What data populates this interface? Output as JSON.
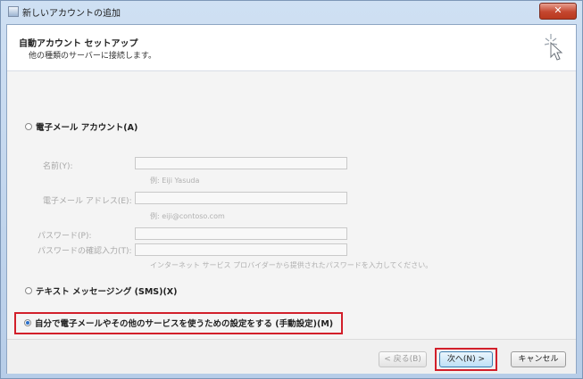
{
  "window": {
    "title": "新しいアカウントの追加",
    "close_glyph": "✕"
  },
  "header": {
    "title": "自動アカウント セットアップ",
    "subtitle": "他の種類のサーバーに接続します。"
  },
  "options": {
    "email_account": "電子メール アカウント(A)",
    "sms": "テキスト メッセージング (SMS)(X)",
    "manual": "自分で電子メールやその他のサービスを使うための設定をする (手動設定)(M)"
  },
  "email_form": {
    "name_label": "名前(Y):",
    "name_hint": "例: Eiji Yasuda",
    "email_label": "電子メール アドレス(E):",
    "email_hint": "例: eiji@contoso.com",
    "password_label": "パスワード(P):",
    "password_confirm_label": "パスワードの確認入力(T):",
    "password_hint": "インターネット サービス プロバイダーから提供されたパスワードを入力してください。"
  },
  "buttons": {
    "back": "< 戻る(B)",
    "next": "次へ(N) >",
    "cancel": "キャンセル"
  },
  "colors": {
    "highlight": "#d21f2a",
    "title_bar": "#b7cde8"
  }
}
